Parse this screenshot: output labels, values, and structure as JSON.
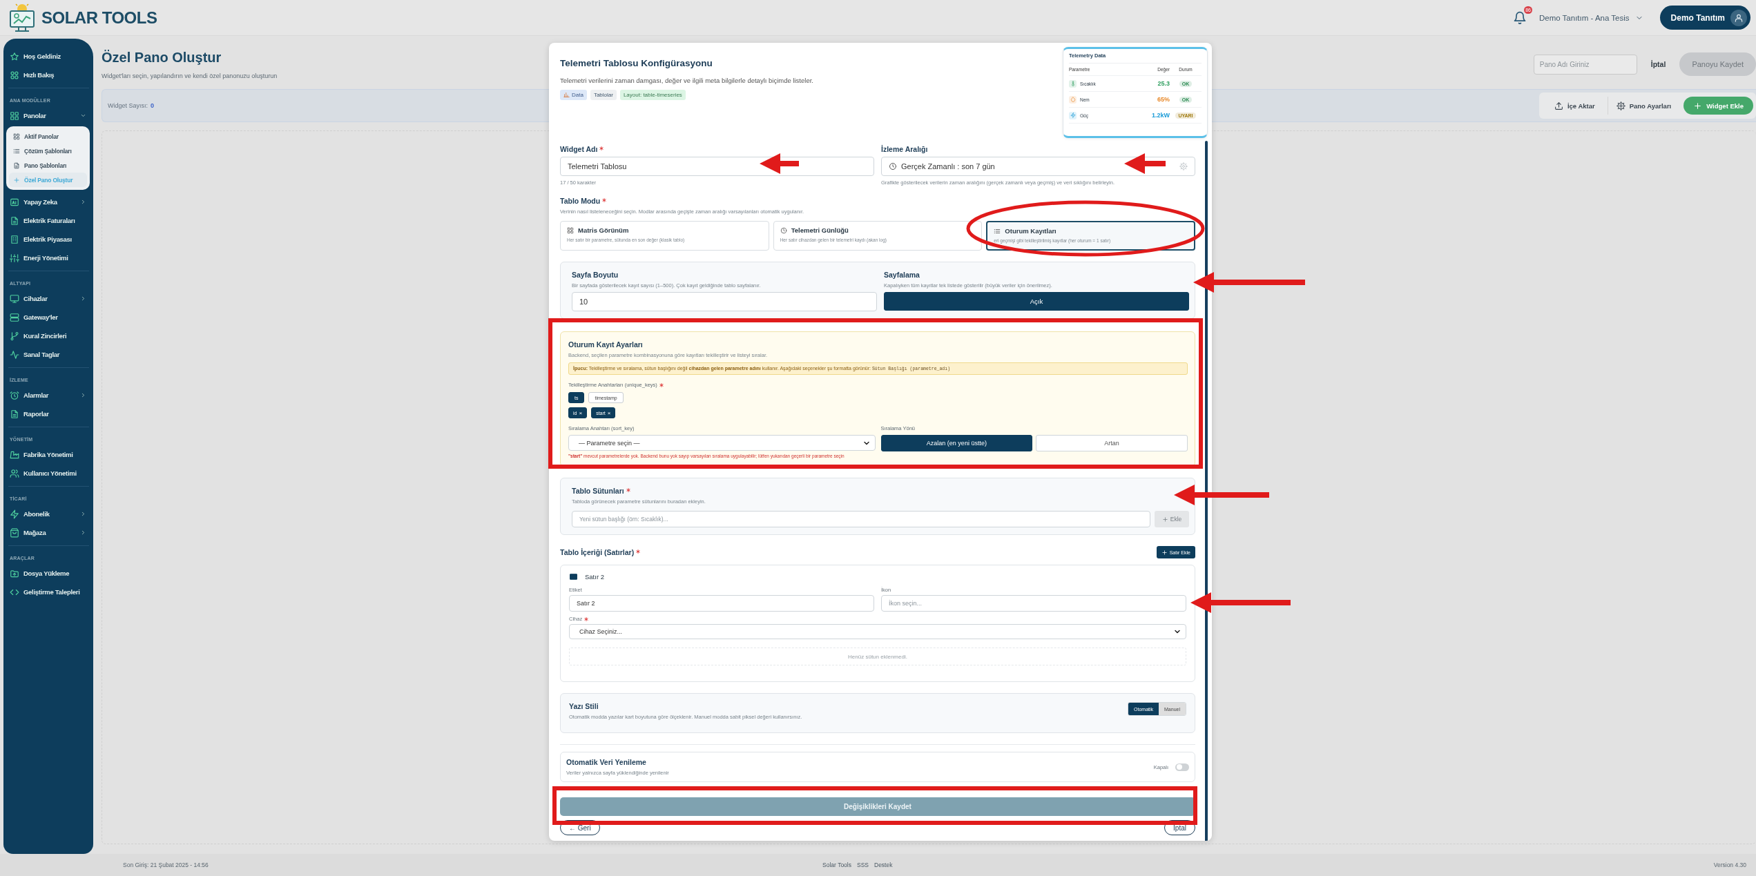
{
  "header": {
    "logo_text": "SOLAR TOOLS",
    "notifications": "86",
    "tenant": "Demo Tanıtım - Ana Tesis",
    "user": "Demo Tanıtım"
  },
  "sidebar": {
    "items": [
      {
        "kind": "item",
        "label": "Hoş Geldiniz",
        "selected": false
      },
      {
        "kind": "item",
        "label": "Hızlı Bakış",
        "selected": false
      },
      {
        "kind": "section",
        "label": "ANA MODÜLLER"
      },
      {
        "kind": "item",
        "label": "Panolar",
        "selected": false,
        "expanded": true,
        "children": [
          {
            "label": "Aktif Panolar",
            "selected": false
          },
          {
            "label": "Çözüm Şablonları",
            "selected": false
          },
          {
            "label": "Pano Şablonları",
            "selected": false
          },
          {
            "label": "Özel Pano Oluştur",
            "selected": true
          }
        ]
      },
      {
        "kind": "item",
        "label": "Yapay Zeka",
        "selected": false,
        "expanded": false
      },
      {
        "kind": "item",
        "label": "Elektrik Faturaları",
        "selected": false
      },
      {
        "kind": "item",
        "label": "Elektrik Piyasası",
        "selected": false
      },
      {
        "kind": "item",
        "label": "Enerji Yönetimi",
        "selected": false
      },
      {
        "kind": "section",
        "label": "ALTYAPI"
      },
      {
        "kind": "item",
        "label": "Cihazlar",
        "selected": false,
        "expanded": false
      },
      {
        "kind": "item",
        "label": "Gateway'ler",
        "selected": false
      },
      {
        "kind": "item",
        "label": "Kural Zincirleri",
        "selected": false
      },
      {
        "kind": "item",
        "label": "Sanal Taglar",
        "selected": false
      },
      {
        "kind": "section",
        "label": "İZLEME"
      },
      {
        "kind": "item",
        "label": "Alarmlar",
        "selected": false,
        "expanded": false
      },
      {
        "kind": "item",
        "label": "Raporlar",
        "selected": false
      },
      {
        "kind": "section",
        "label": "YÖNETİM"
      },
      {
        "kind": "item",
        "label": "Fabrika Yönetimi",
        "selected": false
      },
      {
        "kind": "item",
        "label": "Kullanıcı Yönetimi",
        "selected": false
      },
      {
        "kind": "section",
        "label": "TİCARİ"
      },
      {
        "kind": "item",
        "label": "Abonelik",
        "selected": false,
        "expanded": false
      },
      {
        "kind": "item",
        "label": "Mağaza",
        "selected": false,
        "expanded": false
      },
      {
        "kind": "section",
        "label": "ARAÇLAR"
      },
      {
        "kind": "item",
        "label": "Dosya Yükleme",
        "selected": false
      },
      {
        "kind": "item",
        "label": "Geliştirme Talepleri",
        "selected": false
      }
    ]
  },
  "page": {
    "title": "Özel Pano Oluştur",
    "subtitle": "Widget'ları seçin, yapılandırın ve kendi özel panonuzu oluşturun",
    "name_placeholder": "Pano Adı Giriniz",
    "cancel": "İptal",
    "save": "Panoyu Kaydet",
    "save_disabled": true,
    "widget_count_label": "Widget Sayısı:",
    "widget_count": "0",
    "toolbar": [
      {
        "label": "İçe Aktar",
        "kind": "plain"
      },
      {
        "label": "Pano Ayarları",
        "kind": "plain"
      },
      {
        "label": "Widget Ekle",
        "kind": "primary"
      }
    ]
  },
  "modal": {
    "title": "Telemetri Tablosu Konfigürasyonu",
    "description": "Telemetri verilerini zaman damgası, değer ve ilgili meta bilgilerle detaylı biçimde listeler.",
    "tags": [
      {
        "label": "Data",
        "kind": "category"
      },
      {
        "label": "Tablolar",
        "kind": "group"
      },
      {
        "label": "Layout: table-timeseries",
        "kind": "layout"
      }
    ],
    "preview": {
      "title": "Telemetry Data",
      "columns": [
        "Parametre",
        "Değer",
        "Durum"
      ],
      "rows": [
        {
          "name": "Sıcaklık",
          "value": "25.3",
          "color": "#2e9e5e",
          "status": {
            "label": "OK",
            "color": "#2a8a50"
          }
        },
        {
          "name": "Nem",
          "value": "65%",
          "color": "#e8892a",
          "status": {
            "label": "OK",
            "color": "#2a8a50"
          }
        },
        {
          "name": "Güç",
          "value": "1.2kW",
          "color": "#1a9bd7",
          "status": {
            "label": "UYARI",
            "color": "#a07b10"
          }
        }
      ]
    },
    "widget_name": {
      "label": "Widget Adı",
      "required": true,
      "value": "Telemetri Tablosu",
      "counter": "17 / 50 karakter"
    },
    "interval": {
      "label": "İzleme Aralığı",
      "value": "Gerçek Zamanlı : son 7 gün",
      "hint": "Grafikte gösterilecek verilerin zaman aralığını (gerçek zamanlı veya geçmiş) ve veri sıklığını belirleyin."
    },
    "table_mode": {
      "label": "Tablo Modu",
      "required": true,
      "hint": "Verinin nasıl listeleneceğini seçin. Modlar arasında geçişte zaman aralığı varsayılanları otomatik uygulanır.",
      "options": [
        {
          "title": "Matris Görünüm",
          "description": "Her satır bir parametre, sütunda en son değer (klasik tablo)",
          "selected": false
        },
        {
          "title": "Telemetri Günlüğü",
          "description": "Her satır cihazdan gelen bir telemetri kaydı (akan log)",
          "selected": false
        },
        {
          "title": "Oturum Kayıtları",
          "description": "eri geçmişi gibi tekilleştirilmiş kayıtlar (her oturum = 1 satır)",
          "selected": true
        }
      ]
    },
    "paging": {
      "size_label": "Sayfa Boyutu",
      "size_hint": "Bir sayfada gösterilecek kayıt sayısı (1–500). Çok kayıt geldiğinde tablo sayfalanır.",
      "size_value": "10",
      "label": "Sayfalama",
      "hint": "Kapalıyken tüm kayıtlar tek listede gösterilir (büyük veriler için önerilmez).",
      "button": "Açık",
      "on": true
    },
    "session": {
      "title": "Oturum Kayıt Ayarları",
      "description": "Backend, seçilen parametre kombinasyonuna göre kayıtları tekilleştirir ve listeyi sıralar.",
      "tip": "**İpucu:** Tekilleştirme ve sıralama, sütun başlığını değil **cihazdan gelen parametre adını** kullanır. Aşağıdaki seçenekler şu formatta görünür:",
      "tip_code": "Sütun Başlığı (parametre_adı)",
      "unique_label": "Tekilleştirme Anahtarları (unique_keys)",
      "unique_required": true,
      "key_options": [
        {
          "label": "ts",
          "selected": true
        },
        {
          "label": "timestamp",
          "selected": false
        }
      ],
      "selected_keys": [
        {
          "label": "id",
          "remove": "×"
        },
        {
          "label": "start",
          "remove": "×"
        }
      ],
      "sort_label": "Sıralama Anahtarı (sort_key)",
      "sort_value": "— Parametre seçin —",
      "direction_label": "Sıralama Yönü",
      "directions": [
        {
          "label": "Azalan (en yeni üstte)",
          "selected": true
        },
        {
          "label": "Artan",
          "selected": false
        }
      ],
      "warning": "**\"start\"** mevcut parametrelerde yok. Backend bunu yok sayıp varsayılan sıralama uygulayabilir; lütfen yukarıdan geçerli bir parametre seçin"
    },
    "columns": {
      "title": "Tablo Sütunları",
      "required": true,
      "hint": "Tabloda görünecek parametre sütunlarını buradan ekleyin.",
      "placeholder": "Yeni sütun başlığı (örn: Sıcaklık)...",
      "add": "Ekle",
      "add_disabled": true
    },
    "rows": {
      "title": "Tablo İçeriği (Satırlar)",
      "required": true,
      "add": "Satır Ekle",
      "items": [
        {
          "title": "Satır 2",
          "label_label": "Etiket",
          "label_value": "Satır 2",
          "icon_label": "İkon",
          "icon_placeholder": "İkon seçin...",
          "device_label": "Cihaz",
          "device_required": true,
          "device_value": "Cihaz Seçiniz...",
          "empty": "Henüz sütun eklenmedi."
        }
      ]
    },
    "font_style": {
      "title": "Yazı Stili",
      "hint": "Otomatik modda yazılar kart boyutuna göre ölçeklenir. Manuel modda sabit piksel değeri kullanırsınız.",
      "options": [
        {
          "label": "Otomatik",
          "selected": true
        },
        {
          "label": "Manuel",
          "selected": false
        }
      ]
    },
    "auto_refresh": {
      "title": "Otomatik Veri Yenileme",
      "hint": "Veriler yalnızca sayfa yüklendiğinde yenilenir",
      "state_label": "Kapalı",
      "on": false
    },
    "save": "Değişiklikleri Kaydet",
    "save_disabled": true,
    "back": "← Geri",
    "cancel": "İptal"
  },
  "footer": {
    "last_login": "Son Giriş: 21 Şubat 2025 - 14:56",
    "links": [
      "Solar Tools",
      "SSS",
      "Destek"
    ],
    "version": "Version 4.30"
  }
}
